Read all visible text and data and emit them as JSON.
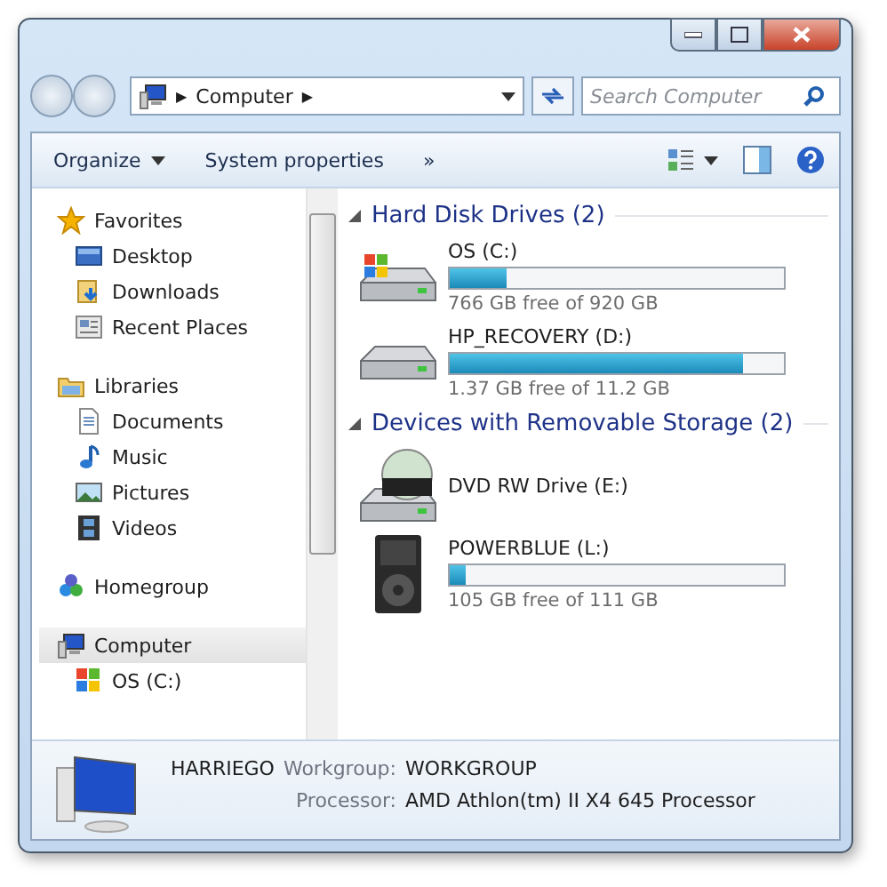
{
  "address_bar": {
    "crumbs": [
      "Computer"
    ],
    "separator": "▶"
  },
  "search": {
    "placeholder": "Search Computer"
  },
  "toolbar": {
    "items": [
      {
        "label": "Organize",
        "dropdown": true
      },
      {
        "label": "System properties",
        "dropdown": false
      }
    ],
    "overflow": "»"
  },
  "navigation": [
    {
      "label": "Favorites",
      "kind": "star",
      "selected": false,
      "children": [
        {
          "label": "Desktop",
          "kind": "desktop",
          "selected": false
        },
        {
          "label": "Downloads",
          "kind": "downloads",
          "selected": false
        },
        {
          "label": "Recent Places",
          "kind": "recent",
          "selected": false
        }
      ]
    },
    {
      "label": "Libraries",
      "kind": "library",
      "selected": false,
      "children": [
        {
          "label": "Documents",
          "kind": "document",
          "selected": false
        },
        {
          "label": "Music",
          "kind": "music",
          "selected": false
        },
        {
          "label": "Pictures",
          "kind": "pictures",
          "selected": false
        },
        {
          "label": "Videos",
          "kind": "videos",
          "selected": false
        }
      ]
    },
    {
      "label": "Homegroup",
      "kind": "homegroup",
      "selected": false
    },
    {
      "label": "Computer",
      "kind": "computer",
      "selected": true,
      "children": [
        {
          "label": "OS (C:)",
          "kind": "drive",
          "selected": false
        }
      ]
    }
  ],
  "groups": [
    {
      "title": "Hard Disk Drives (2)",
      "expanded": true,
      "drives": [
        {
          "name": "OS (C:)",
          "kind": "hdd-windows",
          "level": 0.17,
          "free": "766 GB free of 920 GB"
        },
        {
          "name": "HP_RECOVERY (D:)",
          "kind": "hdd",
          "level": 0.88,
          "free": "1.37 GB free of 11.2 GB"
        }
      ]
    },
    {
      "title": "Devices with Removable Storage (2)",
      "expanded": true,
      "drives": [
        {
          "name": "DVD RW Drive (E:)",
          "kind": "dvd"
        },
        {
          "name": "POWERBLUE (L:)",
          "kind": "player",
          "level": 0.05,
          "free": "105 GB free of 111 GB"
        }
      ]
    }
  ],
  "details": {
    "name": "HARRIEGO",
    "fields": [
      {
        "label": "Workgroup:",
        "value": "WORKGROUP"
      },
      {
        "label": "Processor:",
        "value": "AMD Athlon(tm) II X4 645 Processor"
      }
    ]
  }
}
